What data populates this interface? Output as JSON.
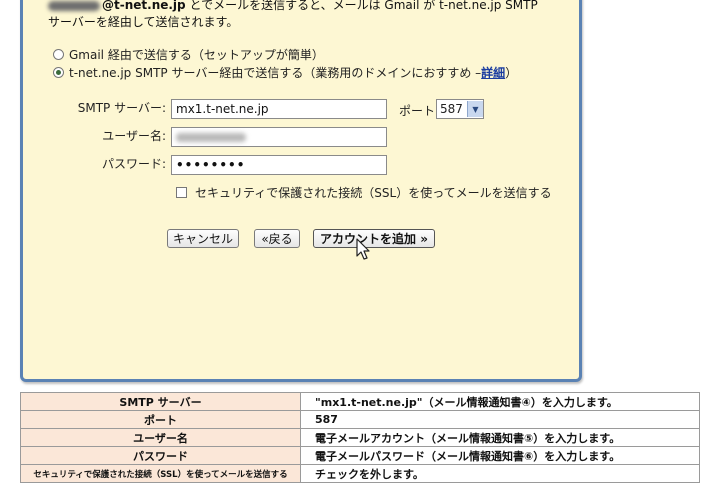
{
  "dialog": {
    "intro_line1_bold": "@t-net.ne.jp",
    "intro_line1_rest": " とでメールを送信すると、メールは Gmail が t-net.ne.jp SMTP",
    "intro_line2": "サーバーを経由して送信されます。",
    "radio_gmail": "Gmail 経由で送信する（セットアップが簡単）",
    "radio_smtp": "t-net.ne.jp SMTP サーバー経由で送信する（業務用のドメインにおすすめ – ",
    "radio_smtp_link": "詳細",
    "radio_smtp_close": "）",
    "smtp_label": "SMTP サーバー:",
    "smtp_value": "mx1.t-net.ne.jp",
    "port_label": "ポート:",
    "port_value": "587",
    "user_label": "ユーザー名:",
    "password_label": "パスワード:",
    "password_value": "••••••••",
    "ssl_label": "セキュリティで保護された接続（SSL）を使ってメールを送信する",
    "cancel_button": "キャンセル",
    "back_button": "«戻る",
    "add_button": "アカウントを追加 »"
  },
  "info_table": {
    "rows": [
      {
        "key": "SMTP サーバー",
        "value": "\"mx1.t-net.ne.jp\"（メール情報通知書④）を入力します。"
      },
      {
        "key": "ポート",
        "value": "587"
      },
      {
        "key": "ユーザー名",
        "value": "電子メールアカウント（メール情報通知書⑤）を入力します。"
      },
      {
        "key": "パスワード",
        "value": "電子メールパスワード（メール情報通知書⑥）を入力します。"
      },
      {
        "key": "セキュリティで保護された接続（SSL）を使ってメールを送信する",
        "value": "チェックを外します。"
      }
    ]
  },
  "icons": {
    "cursor": "cursor-arrow-icon",
    "select_arrow": "chevron-down-icon"
  },
  "colors": {
    "dialog_bg": "#fdf7d3",
    "dialog_border": "#5a82b4",
    "table_key_bg": "#fbe7d8",
    "link": "#1a3ca0"
  }
}
